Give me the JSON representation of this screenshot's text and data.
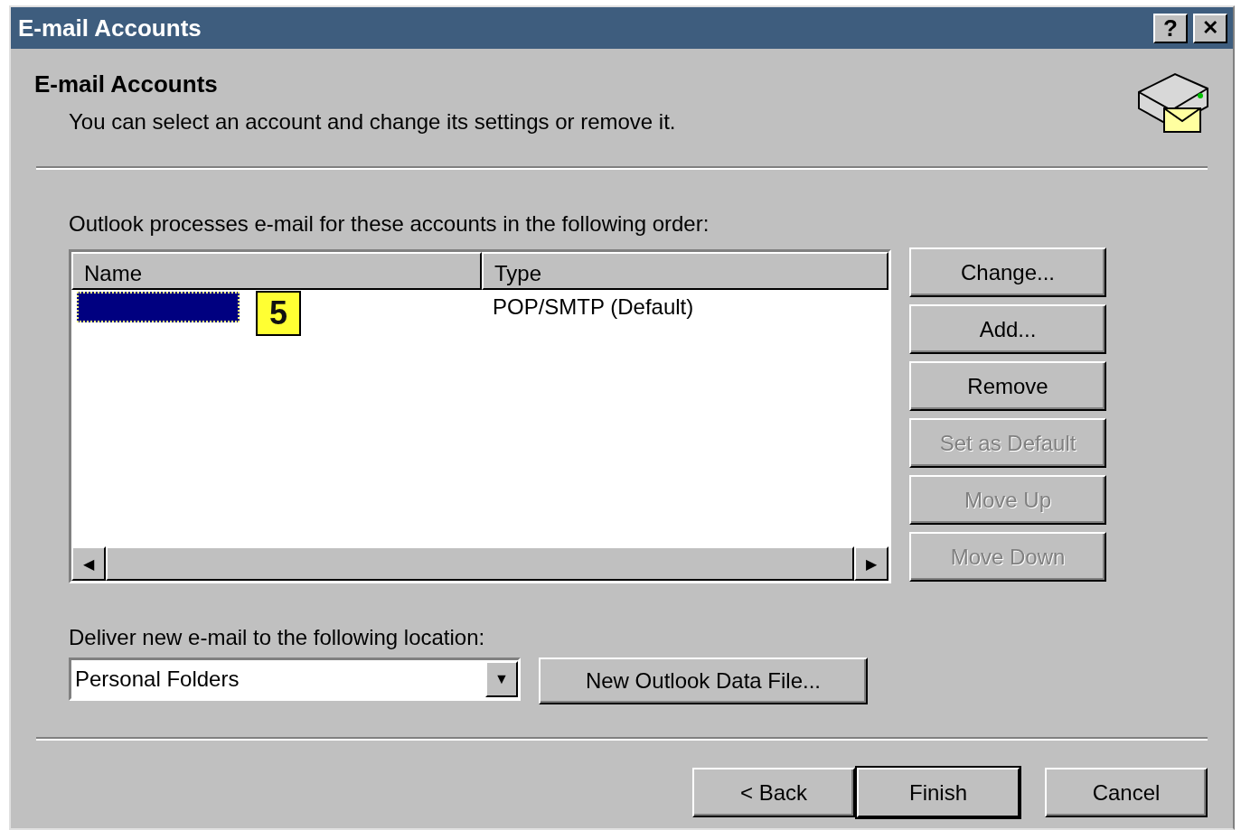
{
  "window": {
    "title": "E-mail Accounts",
    "title_buttons": [
      {
        "kind": "help",
        "label": "?"
      },
      {
        "kind": "close",
        "label": "✕"
      }
    ]
  },
  "header": {
    "title": "E-mail Accounts",
    "subtitle": "You can select an account and change its settings or remove it."
  },
  "accounts": {
    "label": "Outlook processes e-mail for these accounts in the following order:",
    "columns": [
      "Name",
      "Type"
    ],
    "rows": [
      {
        "selected": true,
        "badge": "5",
        "type": "POP/SMTP (Default)"
      }
    ],
    "scroll_left": "◀",
    "scroll_right": "▶"
  },
  "side_buttons": [
    {
      "label": "Change...",
      "disabled": false
    },
    {
      "label": "Add...",
      "disabled": false
    },
    {
      "label": "Remove",
      "disabled": false
    },
    {
      "label": "Set as Default",
      "disabled": true
    },
    {
      "label": "Move Up",
      "disabled": true
    },
    {
      "label": "Move Down",
      "disabled": true
    }
  ],
  "delivery": {
    "label": "Deliver new e-mail to the following location:",
    "value": "Personal Folders",
    "dropdown": "▼",
    "button": {
      "label": "New Outlook Data File..."
    }
  },
  "footer_buttons": [
    {
      "label": "< Back",
      "default": false
    },
    {
      "label": "Finish",
      "default": true
    },
    {
      "label": "Cancel",
      "default": false
    }
  ]
}
